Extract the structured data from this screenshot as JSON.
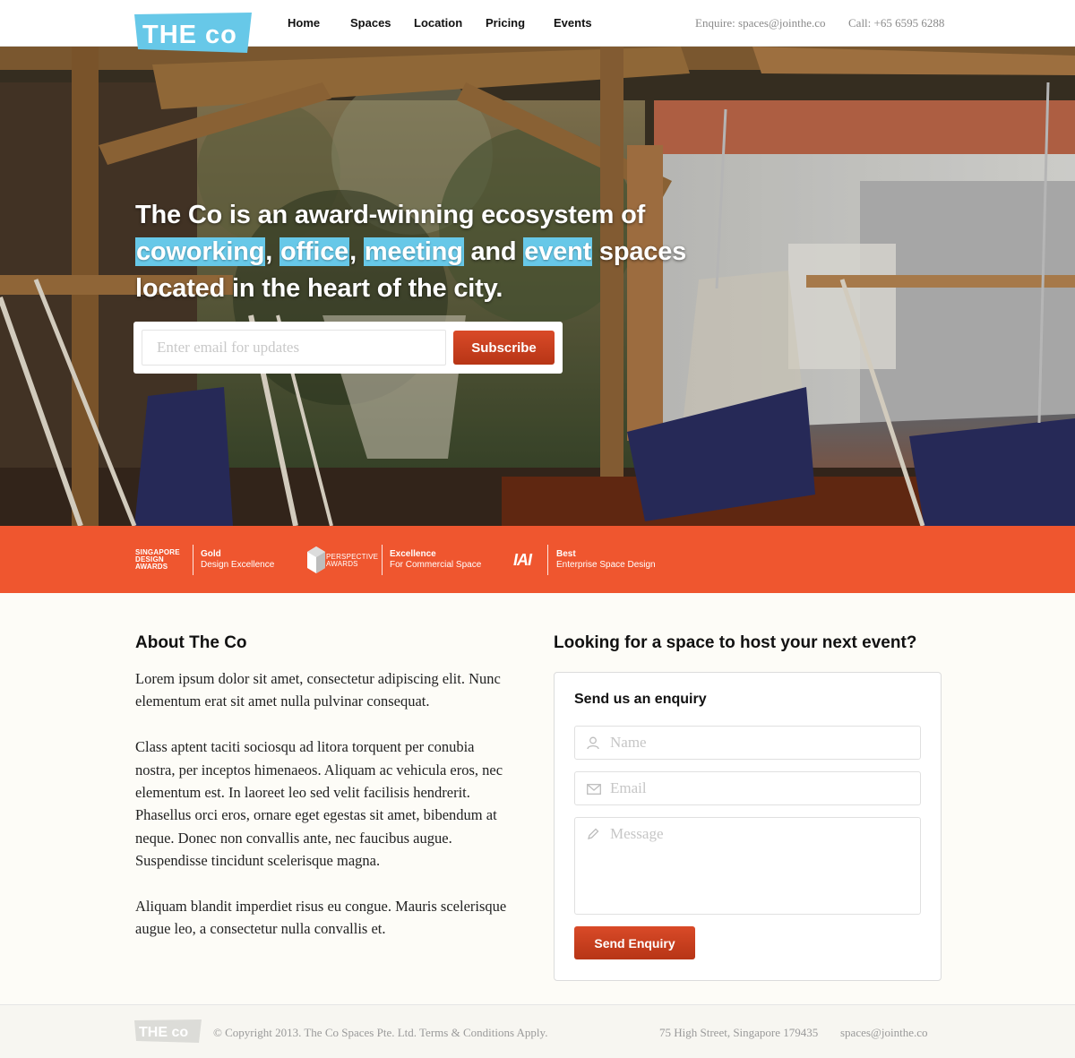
{
  "header": {
    "logo_text": "THE co",
    "nav": [
      {
        "label": "Home"
      },
      {
        "label": "Spaces"
      },
      {
        "label": "Location"
      },
      {
        "label": "Pricing"
      },
      {
        "label": "Events"
      }
    ],
    "enquire": "Enquire: spaces@jointhe.co",
    "call": "Call: +65 6595 6288"
  },
  "hero": {
    "line1": "The Co is an award-winning ecosystem of",
    "hl_coworking": "coworking",
    "comma1": ", ",
    "hl_office": "office",
    "comma2": ", ",
    "hl_meeting": "meeting",
    "and": " and ",
    "hl_event": "event",
    "spaces": " spaces",
    "line3": "located in the heart of the city.",
    "email_placeholder": "Enter email for updates",
    "subscribe_label": "Subscribe"
  },
  "awards": [
    {
      "logo": "SINGAPORE DESIGN AWARDS",
      "logo_lines": [
        "SINGAPORE",
        "DESIGN",
        "AWARDS"
      ],
      "title": "Gold",
      "subtitle": "Design Excellence"
    },
    {
      "logo": "PERSPECTIVE AWARDS",
      "logo_lines": [
        "PERSPECTIVE",
        "AWARDS"
      ],
      "title": "Excellence",
      "subtitle": "For Commercial Space"
    },
    {
      "logo": "IAI",
      "title": "Best",
      "subtitle": "Enterprise Space Design"
    }
  ],
  "about": {
    "title": "About The Co",
    "paragraphs": [
      "Lorem ipsum dolor sit amet, consectetur adipiscing elit. Nunc elementum erat sit amet nulla pulvinar consequat.",
      "Class aptent taciti sociosqu ad litora torquent per conubia nostra, per inceptos himenaeos. Aliquam ac vehicula eros, nec elementum est. In laoreet leo sed velit facilisis hendrerit. Phasellus orci eros, ornare eget egestas sit amet, bibendum at neque. Donec non convallis ante, nec faucibus augue. Suspendisse tincidunt scelerisque magna.",
      "Aliquam blandit imperdiet risus eu congue. Mauris scelerisque augue leo, a consectetur nulla convallis et."
    ]
  },
  "enquiry": {
    "title": "Looking for a space to host your next event?",
    "subtitle": "Send us an enquiry",
    "name_placeholder": "Name",
    "email_placeholder": "Email",
    "message_placeholder": "Message",
    "send_label": "Send Enquiry"
  },
  "footer": {
    "logo_text": "THE co",
    "copyright": "© Copyright 2013. The Co Spaces Pte. Ltd. Terms & Conditions Apply.",
    "address": "75 High Street, Singapore 179435",
    "email": "spaces@jointhe.co"
  },
  "colors": {
    "brand_blue": "#67c8e8",
    "accent_orange": "#ef562f",
    "button_red": "#c93d1d"
  },
  "icons": {
    "name": "person-icon",
    "email": "envelope-icon",
    "message": "pencil-icon"
  }
}
